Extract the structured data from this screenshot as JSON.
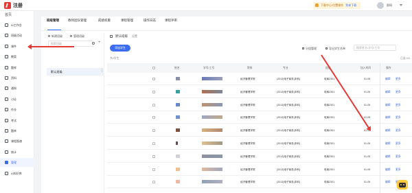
{
  "app": {
    "logo_text": "注册"
  },
  "topbar": {
    "download_text": "下载中心/位置操作",
    "download_link": "到来下载",
    "username": "邵凤"
  },
  "sidebar": {
    "header": "首页",
    "items": [
      {
        "label": "AI工作台",
        "icon": "ai-icon"
      },
      {
        "label": "班级活动",
        "icon": "activity-icon"
      },
      {
        "label": "课件",
        "icon": "courseware-icon"
      },
      {
        "label": "教案",
        "icon": "lesson-plan-icon"
      },
      {
        "label": "题库",
        "icon": "question-bank-icon"
      },
      {
        "label": "资料",
        "icon": "resources-icon"
      },
      {
        "label": "通知",
        "icon": "notice-icon"
      },
      {
        "label": "讨论",
        "icon": "discussion-icon"
      },
      {
        "label": "作业",
        "icon": "homework-icon"
      },
      {
        "label": "考试",
        "icon": "exam-icon"
      },
      {
        "label": "题库",
        "icon": "bank-icon"
      },
      {
        "label": "课程图谱",
        "icon": "graph-icon"
      },
      {
        "label": "统计",
        "icon": "stats-icon"
      },
      {
        "label": "管理",
        "icon": "manage-icon"
      },
      {
        "label": "AI知识库",
        "icon": "kb-icon"
      }
    ]
  },
  "tabs": [
    "班级管理",
    "教师团队管理",
    "成绩权重",
    "课程管理",
    "操作日志",
    "课程评审"
  ],
  "left_panel": {
    "new_class": "新建班级",
    "manage_class": "管理班级",
    "search_placeholder": "搜索班级",
    "class_name": "默认班级"
  },
  "main": {
    "class_title": "默认班级",
    "edit_label": "设置",
    "add_student": "添加学生",
    "tool_group": "分组管理",
    "tool_export": "导出学生名单",
    "search_placeholder": "搜索姓名/学号/工号",
    "count_label": "共0学生",
    "selected_label": "已选 0/0",
    "headers": [
      "姓名",
      "学号/工号",
      "院系",
      "专业",
      "班级",
      "加入时间",
      "操作"
    ],
    "rows": [
      {
        "dept": "经济管理学院",
        "major": "(2013)电子商务(本科)",
        "cls": "电商2301",
        "date": "01-09"
      },
      {
        "dept": "经济管理学院",
        "major": "(2013)电子商务(本科)",
        "cls": "电商2301",
        "date": "01-09"
      },
      {
        "dept": "经济管理学院",
        "major": "(2013)电子商务(本科)",
        "cls": "电商2301",
        "date": "01-09"
      },
      {
        "dept": "经济管理学院",
        "major": "(2013)电子商务(本科)",
        "cls": "电商2301",
        "date": "01-09"
      },
      {
        "dept": "经济管理学院",
        "major": "(2013)电子商务(本科)",
        "cls": "电商2301",
        "date": "01-09"
      },
      {
        "dept": "经济管理学院",
        "major": "(2013)电子商务(本科)",
        "cls": "电商2301",
        "date": "01-09"
      },
      {
        "dept": "经济管理学院",
        "major": "(2013)电子商务(本科)",
        "cls": "电商2301",
        "date": "01-09"
      },
      {
        "dept": "经济管理学院",
        "major": "(2013)电子商务(本科)",
        "cls": "电商2301",
        "date": "01-09"
      },
      {
        "dept": "经济管理学院",
        "major": "(2013)电子商务(本科)",
        "cls": "电商2301",
        "date": "01-09"
      },
      {
        "dept": "经济管理学院",
        "major": "(2013)电子商务(本科)",
        "cls": "电商2301",
        "date": "01-09"
      }
    ],
    "row_action_edit": "编辑",
    "row_action_more": "更多"
  },
  "colors": {
    "accent": "#3c6cf0",
    "annotation": "#e53935"
  }
}
